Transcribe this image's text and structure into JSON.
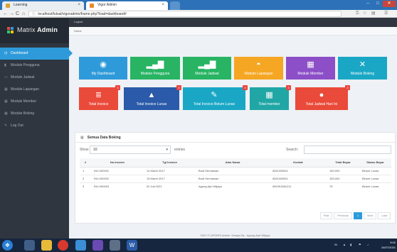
{
  "browser": {
    "tabs": [
      {
        "label": "Learning",
        "close": "×"
      },
      {
        "label": "Vigor Admin",
        "close": "×"
      }
    ],
    "url_prefix": "ⓘ",
    "url": "localhost/futsal/vigoradmin/frame.php?load=dashboard#",
    "controls": {
      "back": "←",
      "forward": "→",
      "reload": "C",
      "home": "⌂"
    },
    "window": {
      "min": "–",
      "max": "□",
      "close": "✕"
    },
    "right_icons": [
      "⚿",
      "☆",
      "▤",
      "☰"
    ]
  },
  "brand": {
    "name_light": "Matrix",
    "name_bold": "Admin"
  },
  "topbar": {
    "logout": "Logout"
  },
  "breadcrumb": {
    "home": "Home"
  },
  "sidebar": {
    "items": [
      {
        "icon": "◷",
        "label": "Dashboard"
      },
      {
        "icon": "▮",
        "label": "Module Pengguna"
      },
      {
        "icon": "▭",
        "label": "Module Jadwal"
      },
      {
        "icon": "▦",
        "label": "Module Lapangan"
      },
      {
        "icon": "▦",
        "label": "Module Member"
      },
      {
        "icon": "▦",
        "label": "Module Boking"
      },
      {
        "icon": "✎",
        "label": "Log Out"
      }
    ]
  },
  "tiles": [
    {
      "icon": "◉",
      "label": "My Dashboard",
      "color": "#2e9ad9"
    },
    {
      "icon": "▂▄▇",
      "label": "Module Pengguna",
      "color": "#28b463"
    },
    {
      "icon": "▂▄▇",
      "label": "Module Jadwal",
      "color": "#28b463"
    },
    {
      "icon": "◓",
      "label": "Module Lapangan",
      "color": "#f5a623"
    },
    {
      "icon": "▦",
      "label": "Module Member",
      "color": "#8c4fc7"
    },
    {
      "icon": "✕",
      "label": "Module Boking",
      "color": "#1aa7c6"
    },
    {
      "icon": "≣",
      "label": "Total Invoice",
      "color": "#ea4a3a",
      "badge": "3"
    },
    {
      "icon": "▲",
      "label": "Total Invoice Lunas",
      "color": "#2a5aa9",
      "badge": "3"
    },
    {
      "icon": "✎",
      "label": "Total Invoice Belum Lunas",
      "color": "#1aa7c6",
      "badge": "3"
    },
    {
      "icon": "▦",
      "label": "Total member",
      "color": "#20a6a5",
      "badge": "3"
    },
    {
      "icon": "●",
      "label": "Total Jadwal Hari Ini",
      "color": "#ea4a3a",
      "badge": "3"
    }
  ],
  "panel": {
    "icon": "▦",
    "title": "Semua Data Boking",
    "show_label": "Show",
    "entries_value": "10",
    "entries_label": "entries",
    "search_label": "Search:",
    "columns": [
      "#",
      "No.Invoice",
      "Tgl Invoice",
      "Atas Nama",
      "Kontak",
      "Total Bayar",
      "Status Bayar"
    ],
    "rows": [
      [
        "1",
        "INV-000001",
        "14 Maret 2017",
        "Budi Hermawan",
        "0821008911",
        "150,000",
        "Belum Lunas"
      ],
      [
        "2",
        "INV-000002",
        "15 Maret 2017",
        "Budi Hermawan",
        "0821008911",
        "150,000",
        "Belum Lunas"
      ],
      [
        "3",
        "INV-000003",
        "02 Juli 2021",
        "Agung Apri Wijaya",
        "081991561211",
        "75",
        "Belum Lunas"
      ]
    ],
    "pager": [
      "First",
      "Previous",
      "1",
      "Next",
      "Last"
    ]
  },
  "footer": "2021 © UPGRIS Admin. Design By : Agung Apri Wijaya",
  "taskbar": {
    "tray_text": "IN",
    "time": "9:02",
    "date": "24/07/2021"
  }
}
